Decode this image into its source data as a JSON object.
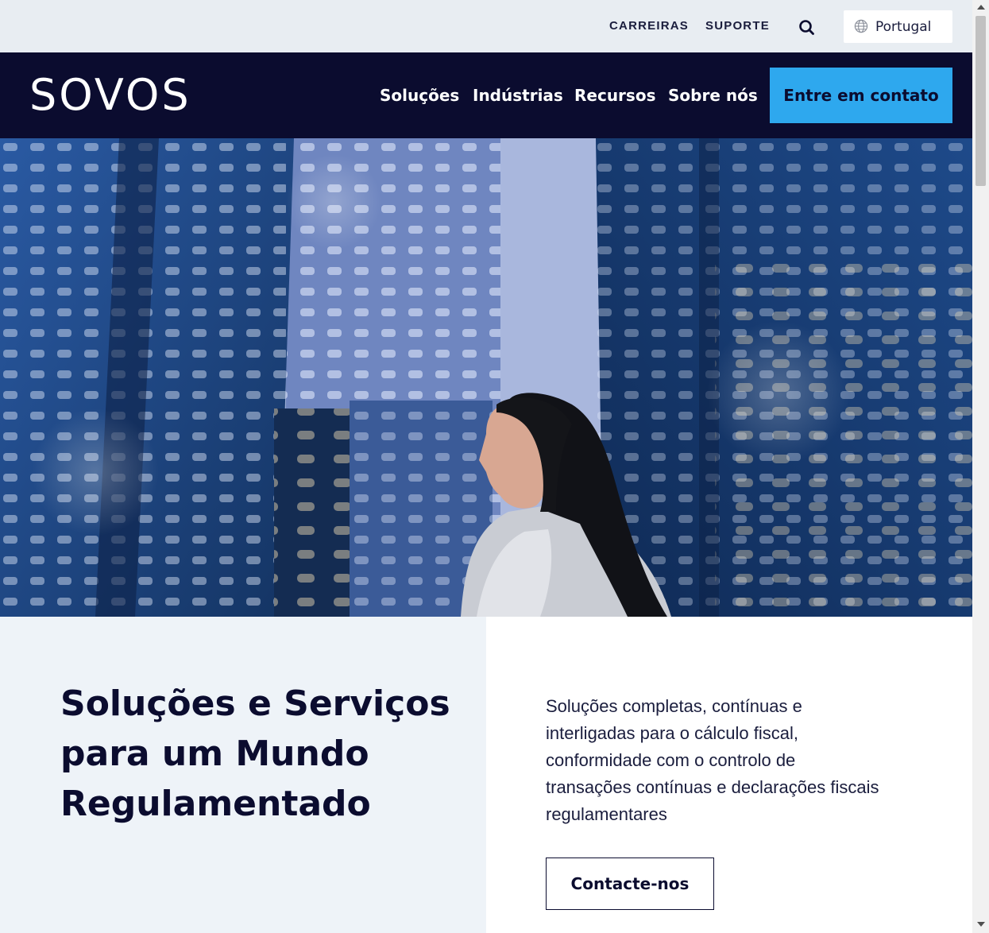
{
  "utility_bar": {
    "careers_label": "CARREIRAS",
    "support_label": "SUPORTE",
    "search_icon": "search-icon",
    "language": {
      "icon": "globe-icon",
      "selected": "Portugal"
    }
  },
  "header": {
    "logo_text": "SOVOS",
    "nav_items": [
      {
        "label": "Soluções"
      },
      {
        "label": "Indústrias"
      },
      {
        "label": "Recursos"
      },
      {
        "label": "Sobre nós"
      }
    ],
    "cta_label": "Entre em contato"
  },
  "hero": {
    "image_alt": ""
  },
  "intro": {
    "headline": "Soluções e Serviços para um Mundo Regulamentado",
    "description": "Soluções completas, contínuas e interligadas para o cálculo fiscal, conformidade com o controlo de transações contínuas e declarações fiscais regulamentares",
    "button_label": "Contacte-nos"
  },
  "colors": {
    "navy": "#0b0c2f",
    "accent_blue": "#2ea8ee",
    "utility_bg": "#e8edf2",
    "panel_bg": "#eef3f8"
  }
}
